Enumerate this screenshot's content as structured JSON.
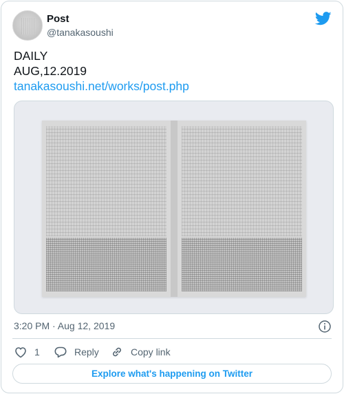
{
  "author": {
    "name": "Post",
    "handle": "@tanakasoushi"
  },
  "tweet": {
    "line1": "DAILY",
    "line2": "AUG,12.2019",
    "link": "tanakasoushi.net/works/post.php"
  },
  "meta": {
    "timestamp": "3:20 PM · Aug 12, 2019"
  },
  "actions": {
    "like_count": "1",
    "reply_label": "Reply",
    "copy_link_label": "Copy link"
  },
  "explore_label": "Explore what's happening on Twitter",
  "colors": {
    "accent": "#1d9bf0",
    "secondary_text": "#536471",
    "border": "#cfd9de"
  },
  "icons": [
    "twitter-bird-icon",
    "info-icon",
    "heart-icon",
    "reply-icon",
    "link-icon"
  ]
}
